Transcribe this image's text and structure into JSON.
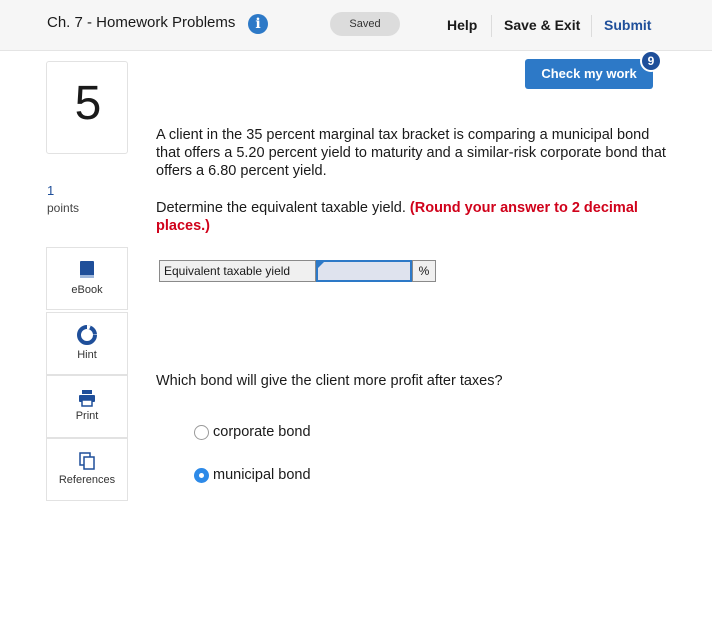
{
  "header": {
    "title": "Ch. 7 - Homework Problems",
    "info_icon": "info-icon",
    "status": "Saved",
    "help": "Help",
    "save_exit": "Save & Exit",
    "submit": "Submit"
  },
  "question_panel": {
    "number": "5",
    "points_value": "1",
    "points_label": "points"
  },
  "tools": [
    {
      "label": "eBook",
      "icon": "book-icon"
    },
    {
      "label": "Hint",
      "icon": "lifebuoy-icon"
    },
    {
      "label": "Print",
      "icon": "printer-icon"
    },
    {
      "label": "References",
      "icon": "copy-icon"
    }
  ],
  "check": {
    "label": "Check my work",
    "remaining": "9"
  },
  "question": {
    "text": "A client in the 35 percent marginal tax bracket is comparing a municipal bond that offers a 5.20 percent yield to maturity and a similar-risk corporate bond that offers a 6.80 percent yield.",
    "instruction": "Determine the equivalent taxable yield.",
    "instruction_note": "(Round your answer to 2 decimal places.)",
    "answer_label": "Equivalent taxable yield",
    "answer_value": "",
    "answer_unit": "%",
    "question2": "Which bond will give the client more profit after taxes?",
    "options": [
      {
        "label": "corporate bond",
        "selected": false
      },
      {
        "label": "municipal bond",
        "selected": true
      }
    ]
  },
  "colors": {
    "accent": "#2d79c7",
    "link": "#1f4f9a",
    "warning": "#d0021b"
  }
}
